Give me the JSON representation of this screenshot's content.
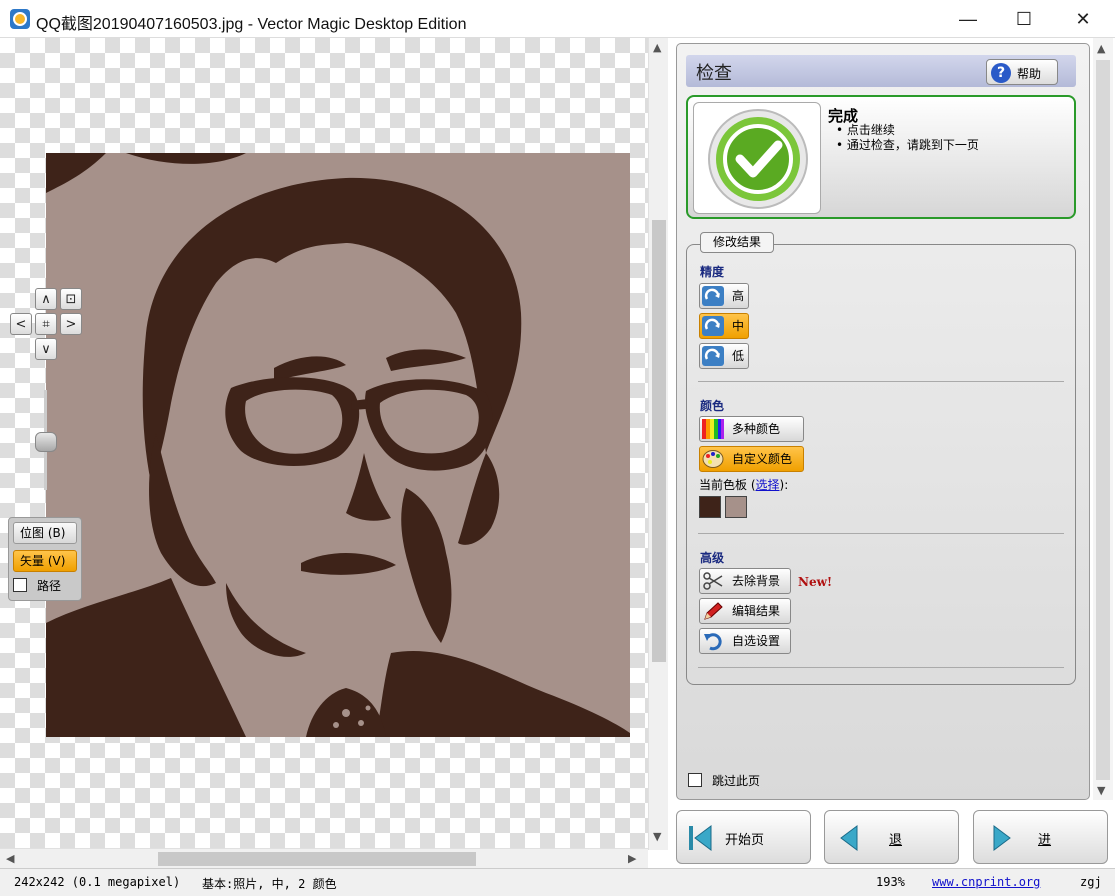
{
  "window": {
    "title": "QQ截图20190407160503.jpg - Vector Magic Desktop Edition",
    "minimize": "—",
    "maximize": "☐",
    "close": "✕"
  },
  "nav": {
    "up": "∧",
    "down": "∨",
    "left": "<",
    "right": ">",
    "center": "⌗",
    "fit": "⊡"
  },
  "view_modes": {
    "bitmap": "位图 (B)",
    "vector": "矢量 (V)",
    "paths": "路径"
  },
  "panel": {
    "title": "检查",
    "help": "帮助",
    "done_title": "完成",
    "done_items": [
      "点击继续",
      "通过检查，请跳到下一页"
    ],
    "modify_group": "修改结果",
    "precision": {
      "heading": "精度",
      "high": "高",
      "medium": "中",
      "low": "低"
    },
    "colors": {
      "heading": "颜色",
      "multi": "多种颜色",
      "custom": "自定义颜色",
      "palette_label": "当前色板 (",
      "palette_link": "选择",
      "palette_end": "):",
      "swatches": [
        "#3e2319",
        "#a6918a"
      ]
    },
    "advanced": {
      "heading": "高级",
      "remove_bg": "去除背景",
      "new_badge": "New!",
      "edit": "编辑结果",
      "custom_settings": "自选设置"
    },
    "skip_page": "跳过此页"
  },
  "bottom_nav": {
    "start": "开始页",
    "back": "退",
    "forward": "进"
  },
  "status": {
    "dims": "242x242 (0.1 megapixel)",
    "basic": "基本:照片, 中, 2 颜色",
    "zoom": "193%",
    "link": "www.cnprint.org",
    "user": "zgj"
  },
  "colors": {
    "dark": "#3e2319",
    "light": "#a6918a",
    "selected": "#f5a800",
    "done_border": "#2a9a2a"
  }
}
